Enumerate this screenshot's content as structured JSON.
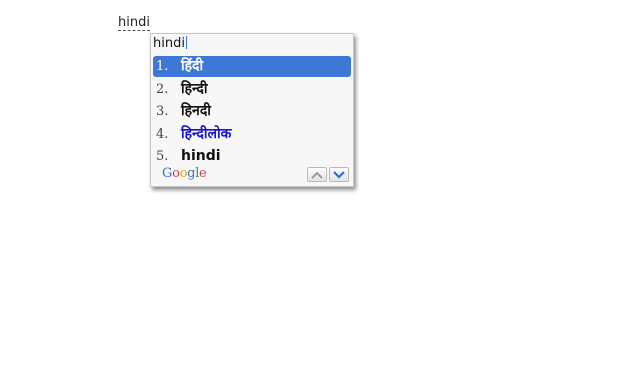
{
  "typed_word": "hindi",
  "ime": {
    "composition_text": "hindi",
    "candidates": [
      {
        "number": "1.",
        "text": "हिंदी"
      },
      {
        "number": "2.",
        "text": "हिन्दी"
      },
      {
        "number": "3.",
        "text": "हिनदी"
      },
      {
        "number": "4.",
        "text": "हिन्दीलोक"
      },
      {
        "number": "5.",
        "text": "hindi"
      }
    ],
    "selected_index": 0,
    "brand": "Google",
    "brand_letters": [
      "G",
      "o",
      "o",
      "g",
      "l",
      "e"
    ],
    "brand_colors": [
      "#3b6fd6",
      "#d8412f",
      "#e5a117",
      "#3b6fd6",
      "#2f9a44",
      "#d8412f"
    ],
    "colors": {
      "selection": "#3d78d6",
      "link_text": "#1515c9",
      "down_arrow": "#2f6fd0",
      "up_arrow": "#9a9a9a"
    },
    "icons": {
      "prev_page": "chevron-up-icon",
      "next_page": "chevron-down-icon"
    }
  }
}
